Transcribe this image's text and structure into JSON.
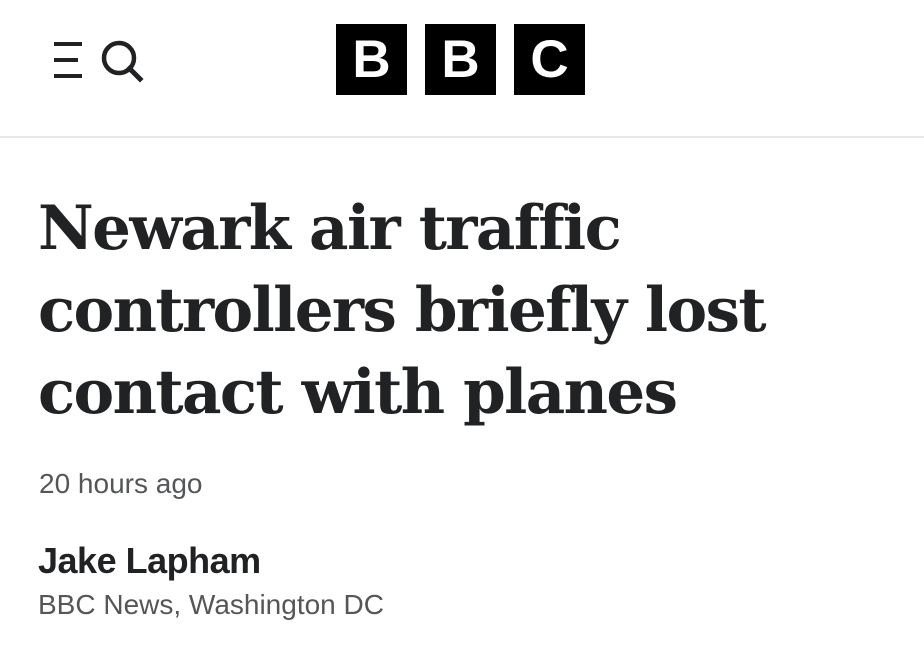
{
  "header": {
    "menu_search_icon": "menu-search-icon",
    "logo": {
      "letters": [
        "B",
        "B",
        "C"
      ]
    },
    "colors": {
      "logo_background": "#000000",
      "logo_text": "#ffffff",
      "divider": "#e6e8ea"
    }
  },
  "article": {
    "headline": "Newark air traffic controllers briefly lost contact with planes",
    "timestamp": "20 hours ago",
    "byline": {
      "author": "Jake Lapham",
      "role": "BBC News, Washington DC"
    },
    "colors": {
      "headline": "#202224",
      "meta": "#545658"
    }
  }
}
